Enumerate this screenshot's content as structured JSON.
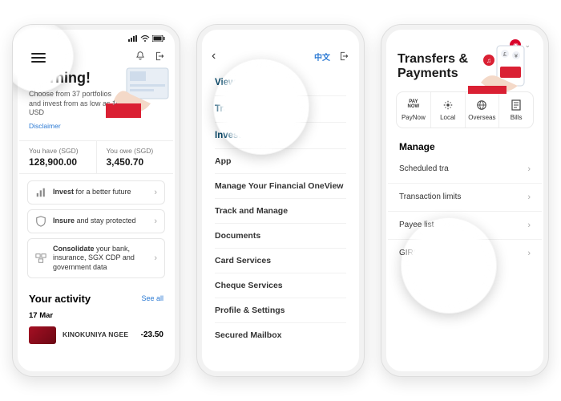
{
  "phone1": {
    "greeting": "Morning!",
    "hero_sub": "Choose from 37 portfolios and invest from as low as 100 USD",
    "disclaimer": "Disclaimer",
    "you_have_label": "You have (SGD)",
    "you_have_amount": "128,900.00",
    "you_owe_label": "You owe (SGD)",
    "you_owe_amount": "3,450.70",
    "card_invest_bold": "Invest",
    "card_invest_rest": " for a better future",
    "card_insure_bold": "Insure",
    "card_insure_rest": " and stay protected",
    "card_consol_bold": "Consolidate",
    "card_consol_rest": " your bank, insurance, SGX CDP and government data",
    "activity_title": "Your activity",
    "see_all": "See all",
    "act_date": "17 Mar",
    "act_merchant": "KINOKUNIYA NGEE",
    "act_amount": "-23.50"
  },
  "phone2": {
    "lang": "中文",
    "items_main": [
      "View Accounts",
      "Transfers & Paym",
      "Invest"
    ],
    "items_sub_app": "App",
    "items_sub": [
      "Manage Your Financial OneView",
      "Track and Manage",
      "Documents",
      "Card Services",
      "Cheque Services",
      "Profile & Settings",
      "Secured Mailbox"
    ]
  },
  "phone3": {
    "title_l1": "Transfers &",
    "title_l2": "Payments",
    "tabs": {
      "paynow": "PayNow",
      "local": "Local",
      "overseas": "Overseas",
      "bills": "Bills"
    },
    "paynow_logo": "PAY\nNOW",
    "manage": "Manage",
    "rows": [
      "Scheduled tra",
      "Transaction limits",
      "Payee list",
      "GIRO services"
    ]
  }
}
